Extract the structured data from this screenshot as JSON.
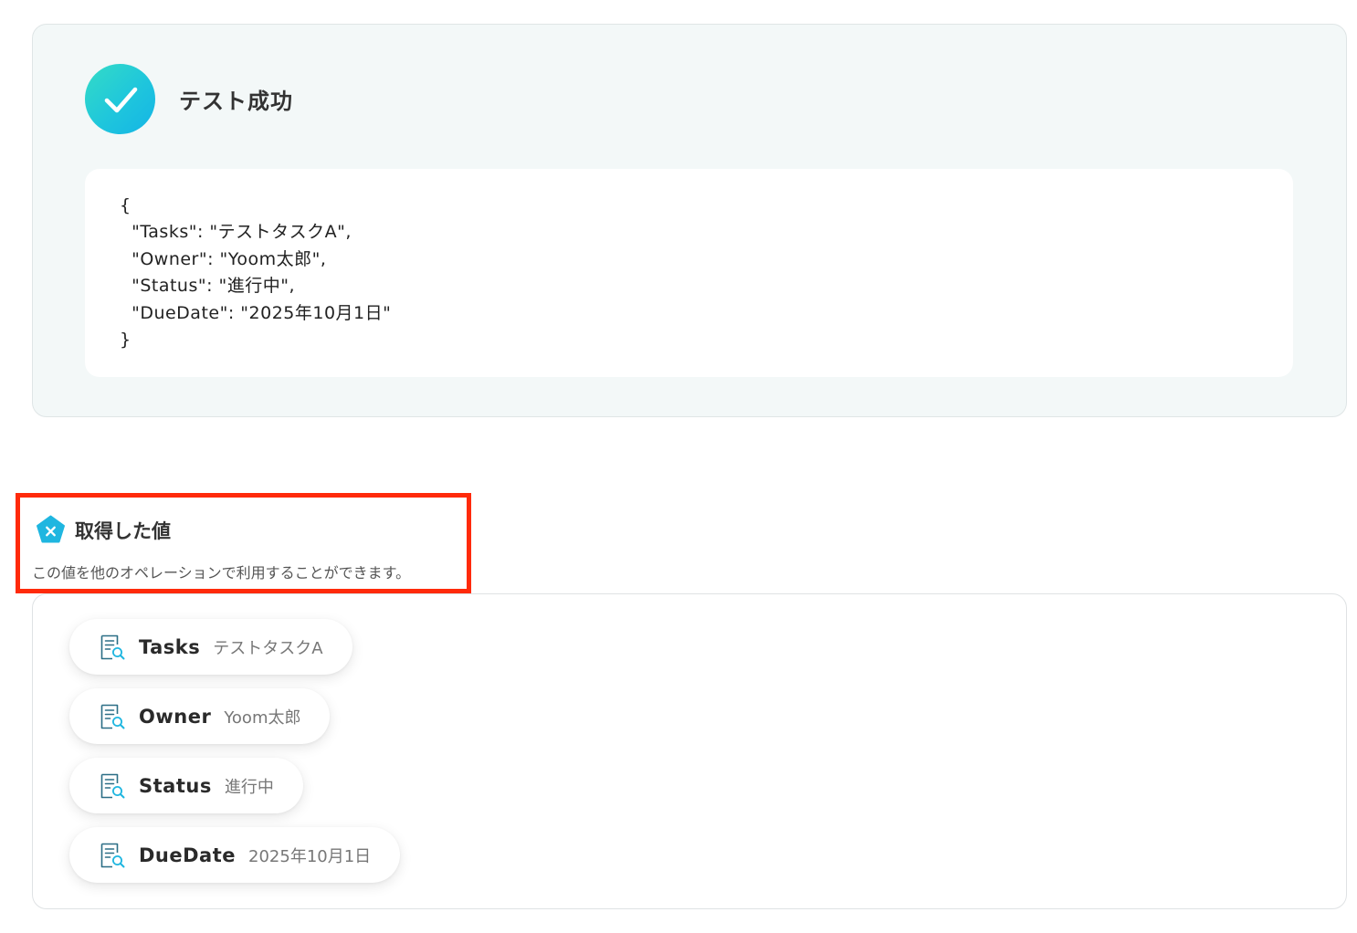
{
  "result": {
    "title": "テスト成功",
    "icon": "check-icon",
    "json_lines": [
      "{",
      "  \"Tasks\": \"テストタスクA\",",
      "  \"Owner\": \"Yoom太郎\",",
      "  \"Status\": \"進行中\",",
      "  \"DueDate\": \"2025年10月1日\"",
      "}"
    ]
  },
  "acquired": {
    "title": "取得した値",
    "description": "この値を他のオペレーションで利用することができます。",
    "icon": "variable-icon",
    "highlight_color": "#ff2a0a"
  },
  "values": [
    {
      "key": "Tasks",
      "value": "テストタスクA",
      "icon": "document-search-icon"
    },
    {
      "key": "Owner",
      "value": "Yoom太郎",
      "icon": "document-search-icon"
    },
    {
      "key": "Status",
      "value": "進行中",
      "icon": "document-search-icon"
    },
    {
      "key": "DueDate",
      "value": "2025年10月1日",
      "icon": "document-search-icon"
    }
  ],
  "colors": {
    "success_gradient_start": "#34dcc6",
    "success_gradient_end": "#14b4e6",
    "panel_bg": "#f3f8f8",
    "icon_blue": "#1fb6e0"
  }
}
